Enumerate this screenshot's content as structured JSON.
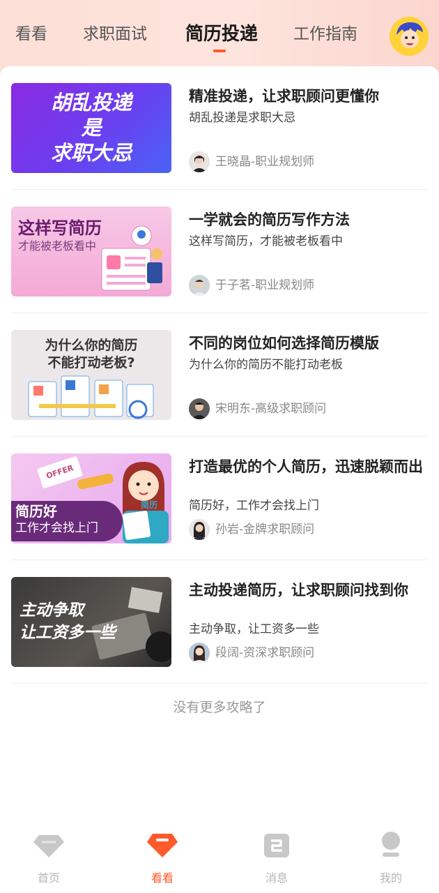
{
  "top_tabs": [
    "看看",
    "求职面试",
    "简历投递",
    "工作指南"
  ],
  "active_tab_index": 2,
  "articles": [
    {
      "thumb_lines": [
        "胡乱投递",
        "是",
        "求职大忌"
      ],
      "title": "精准投递，让求职顾问更懂你",
      "subtitle": "胡乱投递是求职大忌",
      "author": "王晓晶-职业规划师"
    },
    {
      "thumb_lines": [
        "这样写简历",
        "才能被老板看中"
      ],
      "title": "一学就会的简历写作方法",
      "subtitle": "这样写简历，才能被老板看中",
      "author": "于子茗-职业规划师"
    },
    {
      "thumb_lines": [
        "为什么你的简历",
        "不能打动老板?"
      ],
      "title": "不同的岗位如何选择简历模版",
      "subtitle": "为什么你的简历不能打动老板",
      "author": "宋明东-高级求职顾问"
    },
    {
      "thumb_lines": [
        "简历好",
        "工作才会找上门"
      ],
      "thumb_tags": [
        "OFFER",
        "简历"
      ],
      "title": "打造最优的个人简历，迅速脱颖而出",
      "subtitle": "简历好，工作才会找上门",
      "author": "孙岩-金牌求职顾问"
    },
    {
      "thumb_lines": [
        "主动争取",
        "让工资多一些"
      ],
      "title": "主动投递简历，让求职顾问找到你",
      "subtitle": "主动争取，让工资多一些",
      "author": "段阔-资深求职顾问"
    }
  ],
  "no_more_text": "没有更多攻略了",
  "bottom_nav": [
    {
      "label": "首页",
      "icon": "diamond-icon"
    },
    {
      "label": "看看",
      "icon": "look-icon"
    },
    {
      "label": "消息",
      "icon": "message-icon"
    },
    {
      "label": "我的",
      "icon": "profile-icon"
    }
  ],
  "active_nav_index": 1,
  "colors": {
    "accent": "#ff5a2c",
    "header_bg": "#fde0d8",
    "nav_inactive": "#b5b5b5"
  }
}
